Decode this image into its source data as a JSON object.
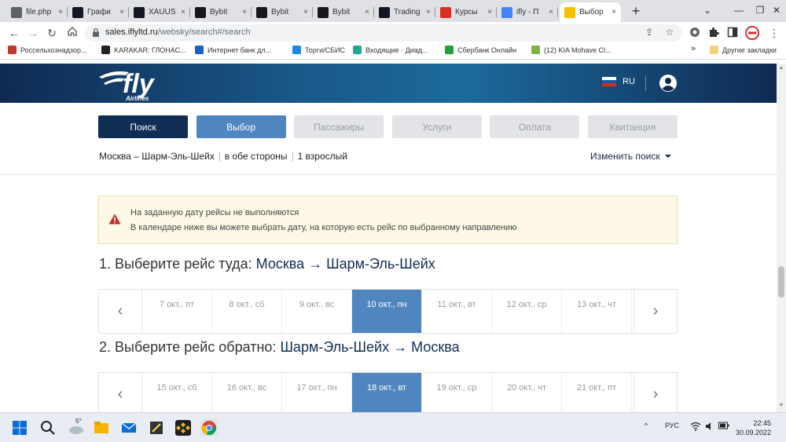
{
  "browser": {
    "tabs": [
      {
        "title": "file.php",
        "icon": "globe-icon",
        "color": "#5f6368"
      },
      {
        "title": "Графи",
        "icon": "tradingview-icon",
        "color": "#131722"
      },
      {
        "title": "XAUUS",
        "icon": "tradingview-icon",
        "color": "#131722"
      },
      {
        "title": "Bybit",
        "icon": "bybit-icon",
        "color": "#17181e"
      },
      {
        "title": "Bybit",
        "icon": "bybit-icon",
        "color": "#17181e"
      },
      {
        "title": "Bybit",
        "icon": "bybit-icon",
        "color": "#17181e"
      },
      {
        "title": "Trading",
        "icon": "tradingview-icon",
        "color": "#131722"
      },
      {
        "title": "Курсы",
        "icon": "f-icon",
        "color": "#d93025"
      },
      {
        "title": "ifly - П",
        "icon": "google-icon",
        "color": "#4285f4"
      },
      {
        "title": "Выбор",
        "icon": "ifly-favicon",
        "color": "#f2c200",
        "active": true
      }
    ],
    "url_host": "sales.iflyltd.ru",
    "url_path": "/websky/search#/search",
    "bookmarks": [
      {
        "label": "Россельхознадзор...",
        "color": "#c0392b"
      },
      {
        "label": "KARAKAR: ГЛОНАС...",
        "color": "#222222"
      },
      {
        "label": "Интернет банк дл...",
        "color": "#1565c0"
      },
      {
        "label": "Торги/СБИС",
        "color": "#1e88e5"
      },
      {
        "label": "Входящие · Диад...",
        "color": "#26a69a"
      },
      {
        "label": "Сбербанк Онлайн",
        "color": "#21a038"
      },
      {
        "label": "(12) KIA Mohave Cl...",
        "color": "#7cb342"
      }
    ],
    "bookmarks_more": "»",
    "other_bookmarks": "Другие закладки"
  },
  "header": {
    "logo_text": "fly",
    "logo_sub": "Airlines",
    "lang": "RU"
  },
  "steps": [
    {
      "label": "Поиск",
      "state": "done"
    },
    {
      "label": "Выбор",
      "state": "cur"
    },
    {
      "label": "Пассажиры",
      "state": "todo"
    },
    {
      "label": "Услуги",
      "state": "todo"
    },
    {
      "label": "Оплата",
      "state": "todo"
    },
    {
      "label": "Квитанция",
      "state": "todo"
    }
  ],
  "summary": {
    "route": "Москва – Шарм-Эль-Шейх",
    "trip_type": "в обе стороны",
    "passengers": "1 взрослый",
    "change_search": "Изменить поиск"
  },
  "alert": {
    "line1": "На заданную дату рейсы не выполняются",
    "line2": "В календаре ниже вы можете выбрать дату, на которую есть рейс по выбранному направлению"
  },
  "outbound": {
    "title_prefix": "1. Выберите рейс туда:",
    "from": "Москва",
    "arrow": "→",
    "to": "Шарм-Эль-Шейх",
    "dates": [
      "7 окт., пт",
      "8 окт., сб",
      "9 окт., вс",
      "10 окт., пн",
      "11 окт., вт",
      "12 окт., ср",
      "13 окт., чт"
    ],
    "selected": "10 окт., пн"
  },
  "return": {
    "title_prefix": "2. Выберите рейс обратно:",
    "from": "Шарм-Эль-Шейх",
    "arrow": "→",
    "to": "Москва",
    "dates": [
      "15 окт., сб",
      "16 окт., вс",
      "17 окт., пн",
      "18 окт., вт",
      "19 окт., ср",
      "20 окт., чт",
      "21 окт., пт"
    ],
    "selected": "18 окт., вт"
  },
  "taskbar": {
    "weather": "5°",
    "lang": "РУС",
    "time": "22:45",
    "date": "30.09.2022"
  }
}
